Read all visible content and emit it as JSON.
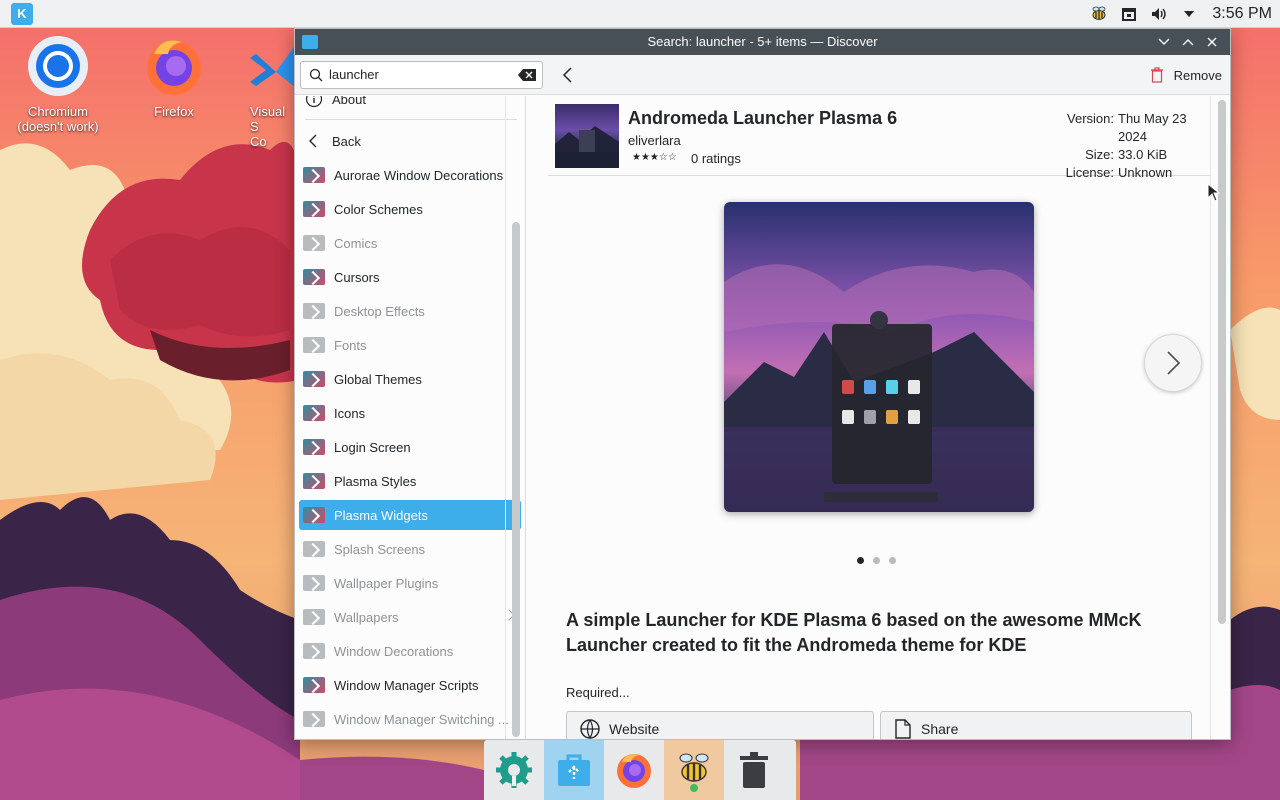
{
  "panel": {
    "clock": "3:56 PM",
    "tray_icons": [
      "bee-icon",
      "lock-icon",
      "volume-icon",
      "chevron-down-icon"
    ]
  },
  "desktop": {
    "icons": [
      {
        "label": "Chromium\n(doesn't work)",
        "icon": "chromium-icon"
      },
      {
        "label": "Firefox",
        "icon": "firefox-icon"
      },
      {
        "label": "Visual S\nCo",
        "icon": "vscode-icon"
      }
    ]
  },
  "window": {
    "title": "Search: launcher - 5+ items — Discover",
    "search_value": "launcher",
    "remove_label": "Remove"
  },
  "sidebar": {
    "about": "About",
    "back": "Back",
    "items": [
      {
        "label": "Aurorae Window Decorations",
        "dim": false
      },
      {
        "label": "Color Schemes",
        "dim": false
      },
      {
        "label": "Comics",
        "dim": true
      },
      {
        "label": "Cursors",
        "dim": false
      },
      {
        "label": "Desktop Effects",
        "dim": true
      },
      {
        "label": "Fonts",
        "dim": true
      },
      {
        "label": "Global Themes",
        "dim": false
      },
      {
        "label": "Icons",
        "dim": false
      },
      {
        "label": "Login Screen",
        "dim": false
      },
      {
        "label": "Plasma Styles",
        "dim": false
      },
      {
        "label": "Plasma Widgets",
        "dim": false,
        "selected": true
      },
      {
        "label": "Splash Screens",
        "dim": true
      },
      {
        "label": "Wallpaper Plugins",
        "dim": true
      },
      {
        "label": "Wallpapers",
        "dim": true,
        "submenu": true
      },
      {
        "label": "Window Decorations",
        "dim": true
      },
      {
        "label": "Window Manager Scripts",
        "dim": false
      },
      {
        "label": "Window Manager Switching ...",
        "dim": true
      }
    ]
  },
  "app": {
    "name": "Andromeda Launcher Plasma 6",
    "author": "eliverlara",
    "rating_stars": "★★★☆☆",
    "ratings": "0 ratings",
    "version_label": "Version:",
    "version": "Thu May 23 2024",
    "size_label": "Size:",
    "size": "33.0 KiB",
    "license_label": "License:",
    "license": "Unknown",
    "screenshot_count": 3,
    "screenshot_index": 1,
    "description": "A simple Launcher for KDE Plasma 6 based on the awesome  MMcK Launcher created to fit the  Andromeda theme for KDE",
    "required": "Required...",
    "website": "Website",
    "share": "Share"
  },
  "dock": {
    "items": [
      "settings-gear-icon",
      "discover-icon",
      "firefox-icon",
      "bee-icon",
      "trash-icon"
    ]
  },
  "colors": {
    "accent": "#3daee9",
    "titlebar": "#475057"
  }
}
